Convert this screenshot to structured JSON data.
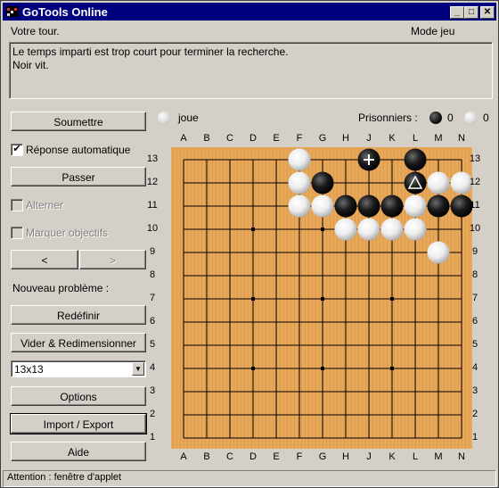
{
  "window": {
    "title": "GoTools Online",
    "controls": [
      "minimize",
      "maximize",
      "close"
    ],
    "minimize_glyph": "_",
    "maximize_glyph": "□",
    "close_glyph": "✕"
  },
  "header": {
    "turn_label": "Votre tour.",
    "mode_label": "Mode jeu"
  },
  "messages": {
    "line1": "Le temps imparti est trop court pour terminer la recherche.",
    "line2": "Noir vit."
  },
  "left_panel": {
    "submit": "Soumettre",
    "auto_reply_label": "Réponse automatique",
    "auto_reply_checked": true,
    "auto_reply_mark": "✔",
    "pass": "Passer",
    "alternate_label": "Alterner",
    "mark_goals_label": "Marquer objectifs",
    "prev": "<",
    "next": ">",
    "new_problem_label": "Nouveau problème :",
    "reset": "Redéfinir",
    "clear_resize": "Vider & Redimensionner",
    "size_select": "13x13",
    "options": "Options",
    "import_export": "Import / Export",
    "help": "Aide"
  },
  "info_bar": {
    "to_play_color": "white",
    "to_play_label": "joue",
    "prisoners_label": "Prisonniers :",
    "prisoners_black": "0",
    "prisoners_white": "0"
  },
  "status": {
    "text": "Attention : fenêtre d'applet"
  },
  "board": {
    "size": 13,
    "columns": [
      "A",
      "B",
      "C",
      "D",
      "E",
      "F",
      "G",
      "H",
      "J",
      "K",
      "L",
      "M",
      "N"
    ],
    "rows": [
      "13",
      "12",
      "11",
      "10",
      "9",
      "8",
      "7",
      "6",
      "5",
      "4",
      "3",
      "2",
      "1"
    ],
    "hoshi": [
      "D10",
      "G10",
      "D7",
      "G7",
      "K7",
      "D4",
      "G4",
      "K4"
    ],
    "stones": [
      {
        "point": "F13",
        "color": "white"
      },
      {
        "point": "J13",
        "color": "black",
        "marker": "cross"
      },
      {
        "point": "L13",
        "color": "black"
      },
      {
        "point": "F12",
        "color": "white"
      },
      {
        "point": "G12",
        "color": "black"
      },
      {
        "point": "L12",
        "color": "black",
        "marker": "triangle"
      },
      {
        "point": "M12",
        "color": "white"
      },
      {
        "point": "N12",
        "color": "white"
      },
      {
        "point": "F11",
        "color": "white"
      },
      {
        "point": "G11",
        "color": "white"
      },
      {
        "point": "H11",
        "color": "black"
      },
      {
        "point": "J11",
        "color": "black"
      },
      {
        "point": "K11",
        "color": "black"
      },
      {
        "point": "L11",
        "color": "white"
      },
      {
        "point": "M11",
        "color": "black"
      },
      {
        "point": "N11",
        "color": "black"
      },
      {
        "point": "H10",
        "color": "white"
      },
      {
        "point": "J10",
        "color": "white"
      },
      {
        "point": "K10",
        "color": "white"
      },
      {
        "point": "L10",
        "color": "white"
      },
      {
        "point": "M9",
        "color": "white"
      }
    ],
    "wood_color": "#e8a85a",
    "line_color": "#000000"
  }
}
